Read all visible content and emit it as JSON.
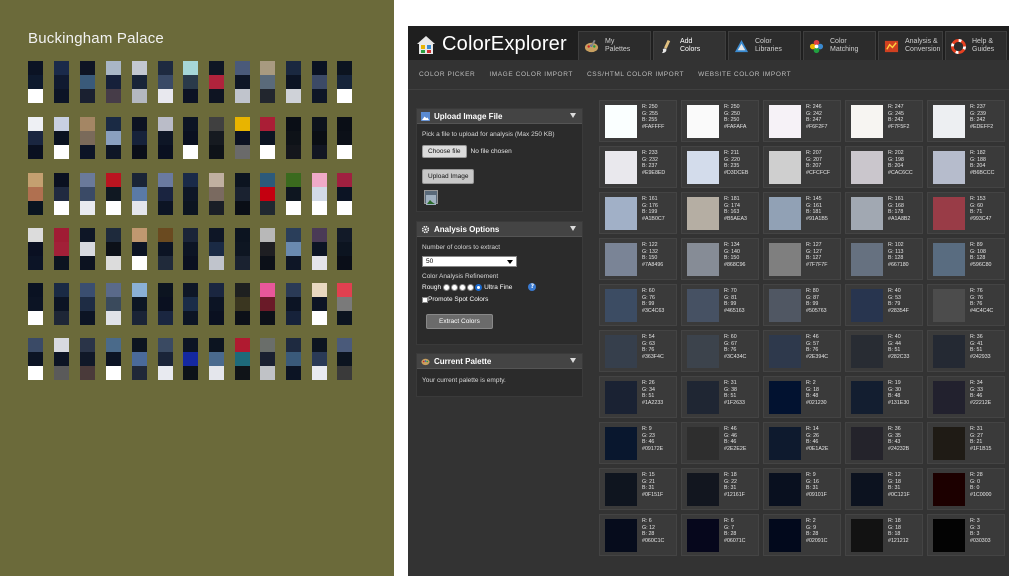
{
  "poster": {
    "title": "Buckingham Palace",
    "rows": [
      [
        [
          "#0b1324",
          "#0e1a2e",
          "#ffffff"
        ],
        [
          "#1a2a4a",
          "#101a30",
          "#0c1426"
        ],
        [
          "#0e1424",
          "#3a5a7a",
          "#1a2030"
        ],
        [
          "#a9b6c6",
          "#16203a",
          "#463c48"
        ],
        [
          "#c3c8d2",
          "#182438",
          "#b4b8c0"
        ],
        [
          "#1e2a40",
          "#3a4a66",
          "#e8e8ee"
        ],
        [
          "#a6d7d8",
          "#2a3a4a",
          "#0c1224"
        ],
        [
          "#0e1624",
          "#b0233c",
          "#0e1422"
        ],
        [
          "#4a5a7a",
          "#0e1626",
          "#c0c4cc"
        ],
        [
          "#a89a80",
          "#5a6a7a",
          "#22262e"
        ],
        [
          "#1a2840",
          "#0c1424",
          "#cfd2d8"
        ],
        [
          "#0a1222",
          "#3c4a66",
          "#0e1626"
        ],
        [
          "#0c1420",
          "#16243a",
          "#ffffff"
        ]
      ],
      [
        [
          "#eef0f4",
          "#1a2640",
          "#0a1020"
        ],
        [
          "#c8d0e2",
          "#0a1220",
          "#ffffff"
        ],
        [
          "#a48664",
          "#7a6a5a",
          "#0c1426"
        ],
        [
          "#1a2a44",
          "#8aa0c0",
          "#0e1626"
        ],
        [
          "#0c1222",
          "#16223a",
          "#0a0e18"
        ],
        [
          "#babcc8",
          "#0e1626",
          "#0a1020"
        ],
        [
          "#0c1424",
          "#0a1020",
          "#ffffff"
        ],
        [
          "#404040",
          "#161a20",
          "#0e1218"
        ],
        [
          "#e8b400",
          "#0c1222",
          "#6a6a6a"
        ],
        [
          "#aa1e36",
          "#0c1422",
          "#ffffff"
        ],
        [
          "#0a0e16",
          "#0e1218",
          "#14161c"
        ],
        [
          "#0c121c",
          "#0a0e14",
          "#121622"
        ],
        [
          "#0a0e16",
          "#0c1018",
          "#ffffff"
        ]
      ],
      [
        [
          "#c4a070",
          "#b07050",
          "#0a1420"
        ],
        [
          "#0a1020",
          "#202a40",
          "#ffffff"
        ],
        [
          "#6a7a9a",
          "#3a4a66",
          "#e8eaf0"
        ],
        [
          "#bb1420",
          "#101822",
          "#ffffff"
        ],
        [
          "#1a2436",
          "#5a7aa6",
          "#e4e6ec"
        ],
        [
          "#6a7aa0",
          "#1a2440",
          "#0c1424"
        ],
        [
          "#1a2a48",
          "#0e1626",
          "#0c1420"
        ],
        [
          "#c0b0a0",
          "#7a6a60",
          "#1a1e26"
        ],
        [
          "#0c1420",
          "#1a2230",
          "#0a0e16"
        ],
        [
          "#2c5a7a",
          "#c40010",
          "#202830"
        ],
        [
          "#3a6a1e",
          "#0e1620",
          "#ffffff"
        ],
        [
          "#f0aac8",
          "#d2dae6",
          "#ffffff"
        ],
        [
          "#a02040",
          "#0c1424",
          "#ffffff"
        ]
      ],
      [
        [
          "#dcdcdc",
          "#0a1022",
          "#0c1426"
        ],
        [
          "#a01c34",
          "#a22038",
          "#0c1420"
        ],
        [
          "#0e1626",
          "#d8dae0",
          "#0c1220"
        ],
        [
          "#1e2a3c",
          "#0c1018",
          "#dcdcdc"
        ],
        [
          "#c09870",
          "#0c1424",
          "#ffffff"
        ],
        [
          "#6a4a20",
          "#0c1424",
          "#202a3a"
        ],
        [
          "#1a2438",
          "#0c1424",
          "#0a1020"
        ],
        [
          "#0e1626",
          "#1a2a44",
          "#c0c4cc"
        ],
        [
          "#0c1420",
          "#0e1622",
          "#1a2230"
        ],
        [
          "#b8b8b8",
          "#1e1e22",
          "#0c1018"
        ],
        [
          "#2a3e5a",
          "#6a8ab0",
          "#0e1626"
        ],
        [
          "#4a3a56",
          "#0c1424",
          "#e4e4ea"
        ],
        [
          "#121a28",
          "#0c1420",
          "#0a0e18"
        ]
      ],
      [
        [
          "#0a1222",
          "#0c1424",
          "#ffffff"
        ],
        [
          "#1a2a44",
          "#0c1424",
          "#1e2636"
        ],
        [
          "#3a4e70",
          "#1e2c44",
          "#0c1424"
        ],
        [
          "#5a6a8a",
          "#3a4a5c",
          "#e0e2e8"
        ],
        [
          "#8ab0d6",
          "#0c1624",
          "#1a2436"
        ],
        [
          "#0c1420",
          "#0a1020",
          "#1a2640"
        ],
        [
          "#0e1626",
          "#1a2c48",
          "#0c1424"
        ],
        [
          "#1a2640",
          "#0c1424",
          "#0a1020"
        ],
        [
          "#1e2020",
          "#3a3620",
          "#0c1018"
        ],
        [
          "#e8579a",
          "#6a1a28",
          "#0c1018"
        ],
        [
          "#2a3a56",
          "#0c1424",
          "#16223a"
        ],
        [
          "#e8d8c0",
          "#0c1424",
          "#ffffff"
        ],
        [
          "#e04050",
          "#7a7a7a",
          "#0c1420"
        ]
      ],
      [
        [
          "#3a4a66",
          "#0c1424",
          "#ffffff"
        ],
        [
          "#d8dae0",
          "#0c1424",
          "#5a5a5a"
        ],
        [
          "#2a3448",
          "#101828",
          "#4a3a3a"
        ],
        [
          "#4a6a8a",
          "#0c1424",
          "#ffffff"
        ],
        [
          "#0c1420",
          "#4a6a9a",
          "#202838"
        ],
        [
          "#3a4a62",
          "#1a2438",
          "#e8eaf0"
        ],
        [
          "#0c1424",
          "#1428a0",
          "#0c1218"
        ],
        [
          "#0c1420",
          "#4a6a8e",
          "#e4e6ec"
        ],
        [
          "#b01a30",
          "#1e6a7a",
          "#101418"
        ],
        [
          "#6a6e6a",
          "#1a2030",
          "#c0c2c6"
        ],
        [
          "#1e2a40",
          "#3a5a7a",
          "#0c1424"
        ],
        [
          "#0c1420",
          "#2a3a56",
          "#e8eaf0"
        ],
        [
          "#4a5a7a",
          "#0c1420",
          "#3a3a3a"
        ]
      ]
    ]
  },
  "app": {
    "logo": "ColorExplorer",
    "tabs": [
      {
        "line1": "My",
        "line2": "Palettes"
      },
      {
        "line1": "Add",
        "line2": "Colors"
      },
      {
        "line1": "Color",
        "line2": "Libraries"
      },
      {
        "line1": "Color",
        "line2": "Matching"
      },
      {
        "line1": "Analysis &",
        "line2": "Conversion"
      },
      {
        "line1": "Help &",
        "line2": "Guides"
      }
    ],
    "subnav": [
      "COLOR PICKER",
      "IMAGE COLOR IMPORT",
      "CSS/HTML COLOR IMPORT",
      "WEBSITE COLOR IMPORT"
    ],
    "upload": {
      "title": "Upload Image File",
      "hint": "Pick a file to upload for analysis (Max 250 KB)",
      "choose_label": "Choose file",
      "no_file": "No file chosen",
      "upload_label": "Upload Image"
    },
    "analysis": {
      "title": "Analysis Options",
      "count_label": "Number of colors to extract",
      "count_value": "50",
      "refine_label": "Color Analysis Refinement",
      "rough": "Rough",
      "fine": "Ultra Fine",
      "spot_label": "Promote Spot Colors",
      "extract_label": "Extract Colors"
    },
    "palette": {
      "title": "Current Palette",
      "empty": "Your current palette is empty."
    },
    "colors": [
      {
        "r": 250,
        "g": 255,
        "b": 255,
        "hex": "#FAFFFF"
      },
      {
        "r": 250,
        "g": 250,
        "b": 250,
        "hex": "#FAFAFA"
      },
      {
        "r": 246,
        "g": 242,
        "b": 247,
        "hex": "#F6F2F7"
      },
      {
        "r": 247,
        "g": 245,
        "b": 242,
        "hex": "#F7F5F2"
      },
      {
        "r": 237,
        "g": 239,
        "b": 242,
        "hex": "#EDEFF2"
      },
      {
        "r": 233,
        "g": 232,
        "b": 237,
        "hex": "#E9E8ED"
      },
      {
        "r": 211,
        "g": 220,
        "b": 235,
        "hex": "#D3DCEB"
      },
      {
        "r": 207,
        "g": 207,
        "b": 207,
        "hex": "#CFCFCF"
      },
      {
        "r": 202,
        "g": 198,
        "b": 204,
        "hex": "#CAC6CC"
      },
      {
        "r": 182,
        "g": 188,
        "b": 204,
        "hex": "#B6BCCC"
      },
      {
        "r": 161,
        "g": 176,
        "b": 199,
        "hex": "#A1B0C7"
      },
      {
        "r": 181,
        "g": 174,
        "b": 163,
        "hex": "#B5AEA3"
      },
      {
        "r": 145,
        "g": 161,
        "b": 181,
        "hex": "#91A1B5"
      },
      {
        "r": 161,
        "g": 168,
        "b": 178,
        "hex": "#A1A8B2"
      },
      {
        "r": 153,
        "g": 60,
        "b": 71,
        "hex": "#993C47"
      },
      {
        "r": 122,
        "g": 132,
        "b": 150,
        "hex": "#7A8496"
      },
      {
        "r": 134,
        "g": 140,
        "b": 150,
        "hex": "#868C96"
      },
      {
        "r": 127,
        "g": 127,
        "b": 127,
        "hex": "#7F7F7F"
      },
      {
        "r": 102,
        "g": 113,
        "b": 128,
        "hex": "#667180"
      },
      {
        "r": 89,
        "g": 108,
        "b": 128,
        "hex": "#596C80"
      },
      {
        "r": 60,
        "g": 76,
        "b": 99,
        "hex": "#3C4C63"
      },
      {
        "r": 70,
        "g": 81,
        "b": 99,
        "hex": "#465163"
      },
      {
        "r": 80,
        "g": 87,
        "b": 99,
        "hex": "#505763"
      },
      {
        "r": 40,
        "g": 53,
        "b": 79,
        "hex": "#28354F"
      },
      {
        "r": 76,
        "g": 76,
        "b": 76,
        "hex": "#4C4C4C"
      },
      {
        "r": 54,
        "g": 63,
        "b": 76,
        "hex": "#363F4C"
      },
      {
        "r": 60,
        "g": 67,
        "b": 76,
        "hex": "#3C434C"
      },
      {
        "r": 46,
        "g": 57,
        "b": 76,
        "hex": "#2E394C"
      },
      {
        "r": 40,
        "g": 44,
        "b": 51,
        "hex": "#282C33"
      },
      {
        "r": 36,
        "g": 41,
        "b": 51,
        "hex": "#242933"
      },
      {
        "r": 26,
        "g": 34,
        "b": 51,
        "hex": "#1A2233"
      },
      {
        "r": 31,
        "g": 38,
        "b": 51,
        "hex": "#1F2633"
      },
      {
        "r": 2,
        "g": 18,
        "b": 48,
        "hex": "#021230"
      },
      {
        "r": 19,
        "g": 30,
        "b": 48,
        "hex": "#131E30"
      },
      {
        "r": 34,
        "g": 33,
        "b": 46,
        "hex": "#22212E"
      },
      {
        "r": 9,
        "g": 23,
        "b": 46,
        "hex": "#09172E"
      },
      {
        "r": 46,
        "g": 46,
        "b": 46,
        "hex": "#2E2E2E"
      },
      {
        "r": 14,
        "g": 26,
        "b": 46,
        "hex": "#0E1A2E"
      },
      {
        "r": 36,
        "g": 35,
        "b": 43,
        "hex": "#24232B"
      },
      {
        "r": 31,
        "g": 27,
        "b": 21,
        "hex": "#1F1B15"
      },
      {
        "r": 15,
        "g": 21,
        "b": 31,
        "hex": "#0F151F"
      },
      {
        "r": 18,
        "g": 22,
        "b": 31,
        "hex": "#12161F"
      },
      {
        "r": 9,
        "g": 16,
        "b": 31,
        "hex": "#09101F"
      },
      {
        "r": 12,
        "g": 18,
        "b": 31,
        "hex": "#0C121F"
      },
      {
        "r": 28,
        "g": 0,
        "b": 0,
        "hex": "#1C0000"
      },
      {
        "r": 6,
        "g": 12,
        "b": 28,
        "hex": "#060C1C"
      },
      {
        "r": 6,
        "g": 7,
        "b": 28,
        "hex": "#06071C"
      },
      {
        "r": 2,
        "g": 9,
        "b": 28,
        "hex": "#02091C"
      },
      {
        "r": 18,
        "g": 18,
        "b": 18,
        "hex": "#121212"
      },
      {
        "r": 3,
        "g": 3,
        "b": 3,
        "hex": "#030303"
      }
    ]
  }
}
